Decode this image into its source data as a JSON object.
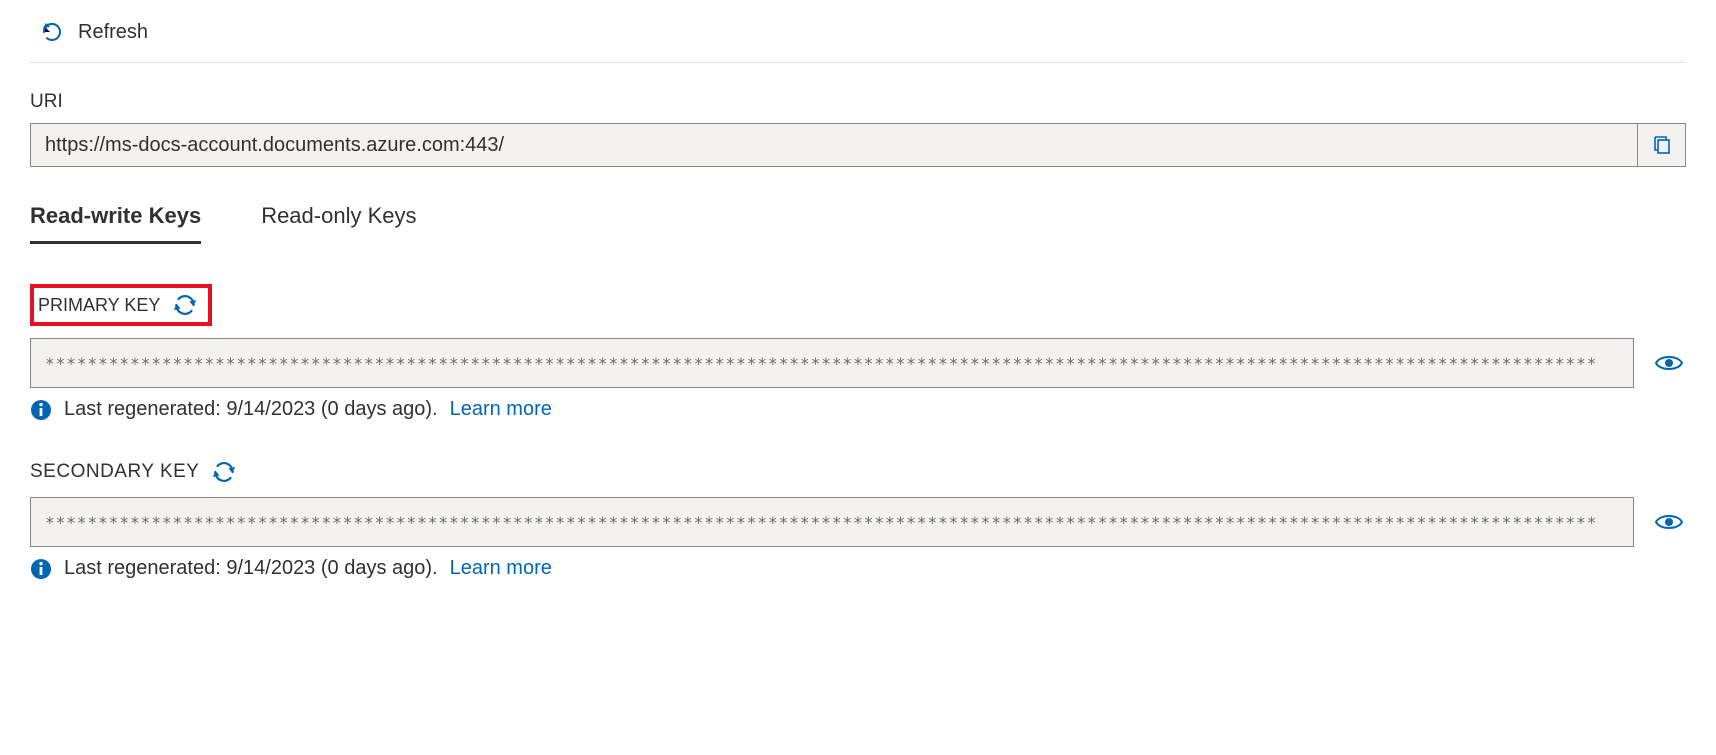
{
  "toolbar": {
    "refresh_label": "Refresh"
  },
  "uri": {
    "label": "URI",
    "value": "https://ms-docs-account.documents.azure.com:443/"
  },
  "tabs": {
    "readwrite": "Read-write Keys",
    "readonly": "Read-only Keys"
  },
  "primary": {
    "label": "PRIMARY KEY",
    "masked": "**************************************************************************************************************************************************",
    "last_regen": "Last regenerated: 9/14/2023 (0 days ago).",
    "learn_more": "Learn more"
  },
  "secondary": {
    "label": "SECONDARY KEY",
    "masked": "**************************************************************************************************************************************************",
    "last_regen": "Last regenerated: 9/14/2023 (0 days ago).",
    "learn_more": "Learn more"
  }
}
